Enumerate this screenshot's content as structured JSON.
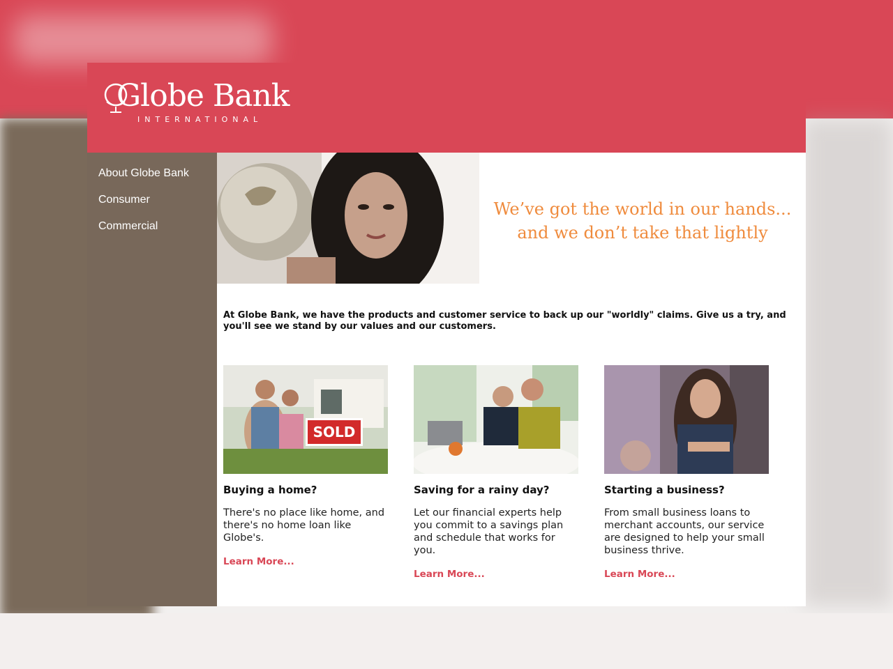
{
  "brand": {
    "name": "Globe Bank",
    "tagline_small": "INTERNATIONAL",
    "primary_color": "#d94756",
    "sidebar_color": "#78685a",
    "accent_color": "#ef8b3d"
  },
  "sidebar": {
    "items": [
      {
        "label": "About Globe Bank"
      },
      {
        "label": "Consumer"
      },
      {
        "label": "Commercial"
      }
    ]
  },
  "hero": {
    "line1": "We’ve got the world in our hands...",
    "line2": "and we don’t take that lightly",
    "photo_icon": "woman-holding-globe-photo"
  },
  "intro": "At Globe Bank, we have the products and customer service to back up our \"worldly\" claims. Give us a try, and you'll see we stand by our values and our customers.",
  "cards": [
    {
      "title": "Buying a home?",
      "body": "There's no place like home, and there's no home loan like Globe's.",
      "link": "Learn More...",
      "sign": "SOLD",
      "photo_icon": "family-sold-home-photo"
    },
    {
      "title": "Saving for a rainy day?",
      "body": "Let our financial experts help you commit to a savings plan and schedule that works for you.",
      "link": "Learn More...",
      "photo_icon": "couple-with-laptop-photo"
    },
    {
      "title": "Starting a business?",
      "body": "From small business loans to merchant accounts, our service are designed to help your small business thrive.",
      "link": "Learn More...",
      "photo_icon": "salon-owner-photo"
    }
  ]
}
